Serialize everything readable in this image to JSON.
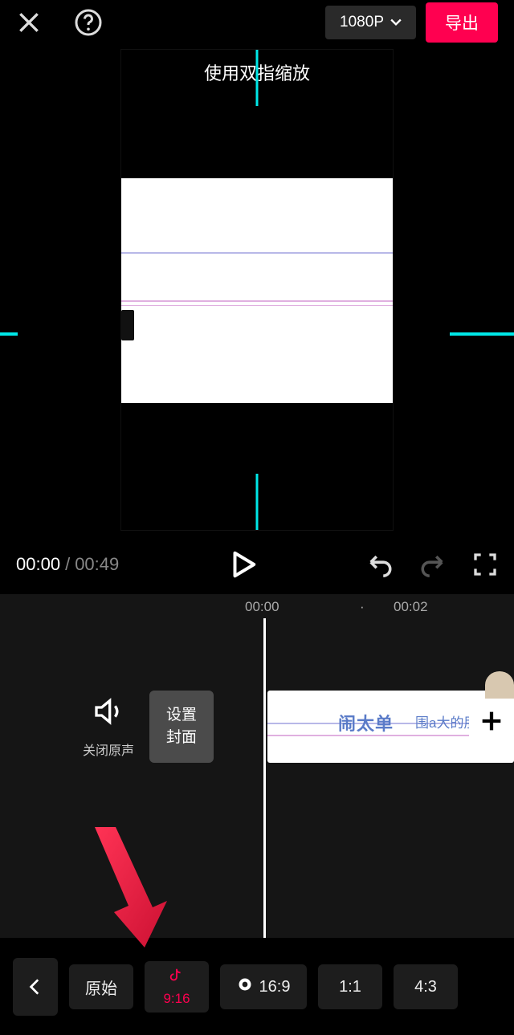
{
  "header": {
    "resolution": "1080P",
    "export": "导出"
  },
  "preview": {
    "hint": "使用双指缩放"
  },
  "playback": {
    "current": "00:00",
    "sep": "/",
    "total": "00:49"
  },
  "timeline": {
    "t1": "00:00",
    "t2": "00:02",
    "mute": "关闭原声",
    "cover": "设置\n封面",
    "clip_text": "闹太单",
    "clip_sub": "围a大的朋"
  },
  "ratios": {
    "original": "原始",
    "r916": "9:16",
    "r169": "16:9",
    "r11": "1:1",
    "r43": "4:3"
  }
}
